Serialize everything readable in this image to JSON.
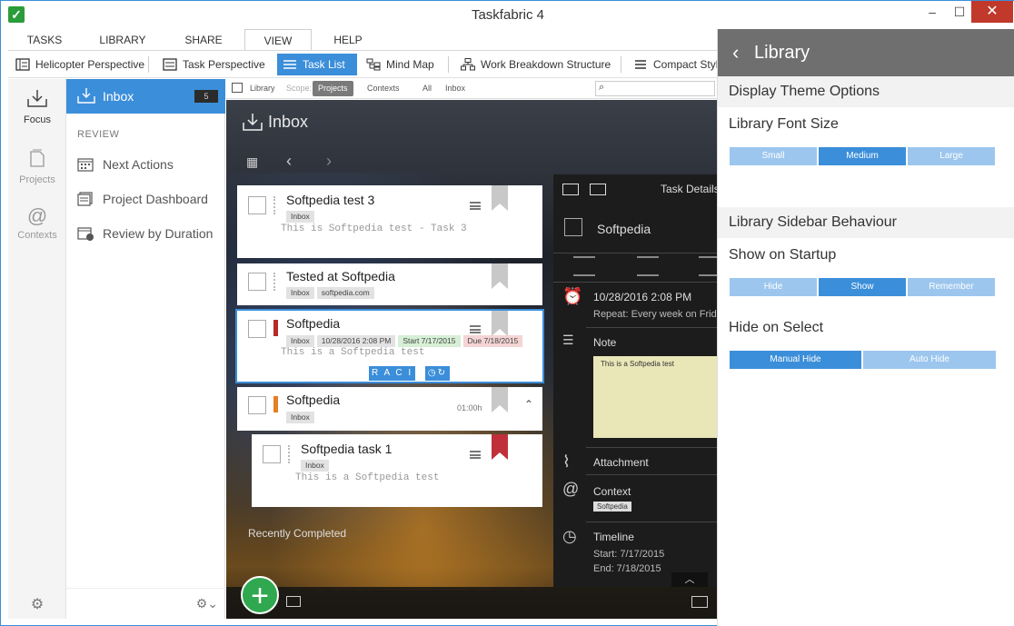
{
  "window": {
    "title": "Taskfabric 4"
  },
  "ribbon": {
    "tabs": [
      {
        "label": "TASKS"
      },
      {
        "label": "LIBRARY"
      },
      {
        "label": "SHARE"
      },
      {
        "label": "VIEW"
      },
      {
        "label": "HELP"
      }
    ],
    "active_tab": "VIEW",
    "buttons": [
      {
        "label": "Helicopter Perspective"
      },
      {
        "label": "Task Perspective"
      },
      {
        "label": "Task List"
      },
      {
        "label": "Mind Map"
      },
      {
        "label": "Work Breakdown Structure"
      },
      {
        "label": "Compact Style"
      }
    ]
  },
  "leftnav": {
    "items": [
      {
        "label": "Focus",
        "icon": "focus-icon"
      },
      {
        "label": "Projects",
        "icon": "projects-icon"
      },
      {
        "label": "Contexts",
        "icon": "contexts-icon"
      }
    ]
  },
  "sidebar": {
    "inbox_label": "Inbox",
    "inbox_count": "5",
    "review_heading": "REVIEW",
    "items": [
      {
        "label": "Next Actions"
      },
      {
        "label": "Project Dashboard"
      },
      {
        "label": "Review by Duration"
      }
    ]
  },
  "scopebar": {
    "library": "Library",
    "scope": "Scope:",
    "projects": "Projects",
    "contexts": "Contexts",
    "all": "All",
    "inbox": "Inbox"
  },
  "main": {
    "title": "Inbox",
    "recently_completed": "Recently Completed",
    "tasks": [
      {
        "title": "Softpedia test 3",
        "tags": [
          "Inbox"
        ],
        "desc": "This is Softpedia test - Task 3"
      },
      {
        "title": "Tested at Softpedia",
        "tags": [
          "Inbox",
          "softpedia.com"
        ],
        "desc": ""
      },
      {
        "title": "Softpedia",
        "tags": [
          "Inbox",
          "10/28/2016 2:08 PM",
          "Start 7/17/2015",
          "Due 7/18/2015"
        ],
        "desc": "This is a Softpedia test",
        "raci": "R A C I"
      },
      {
        "title": "Softpedia",
        "tags": [
          "Inbox"
        ],
        "desc": "",
        "duration": "01:00h"
      },
      {
        "title": "Softpedia task 1",
        "tags": [
          "Inbox"
        ],
        "desc": "This is a Softpedia test"
      }
    ]
  },
  "details": {
    "header": "Task Details",
    "title": "Softpedia",
    "reminder_date": "10/28/2016 2:08 PM",
    "reminder_repeat": "Repeat: Every week on Frid",
    "note_label": "Note",
    "note_text": "This is a Softpedia test",
    "attachment_label": "Attachment",
    "context_label": "Context",
    "context_value": "Softpedia",
    "timeline_label": "Timeline",
    "timeline_start": "Start: 7/17/2015",
    "timeline_end": "End: 7/18/2015"
  },
  "library": {
    "title": "Library",
    "display_theme": "Display Theme Options",
    "font_size_label": "Library Font Size",
    "font_sizes": [
      "Small",
      "Medium",
      "Large"
    ],
    "font_size_selected": "Medium",
    "sidebar_behaviour": "Library Sidebar Behaviour",
    "show_startup_label": "Show on Startup",
    "startup_options": [
      "Hide",
      "Show",
      "Remember"
    ],
    "startup_selected": "Show",
    "hide_select_label": "Hide on Select",
    "hide_options": [
      "Manual Hide",
      "Auto Hide"
    ],
    "hide_selected": "Manual Hide"
  },
  "colors": {
    "accent": "#3b8ed9",
    "add_button": "#2fa84f",
    "library_header": "#6f6f6f"
  }
}
